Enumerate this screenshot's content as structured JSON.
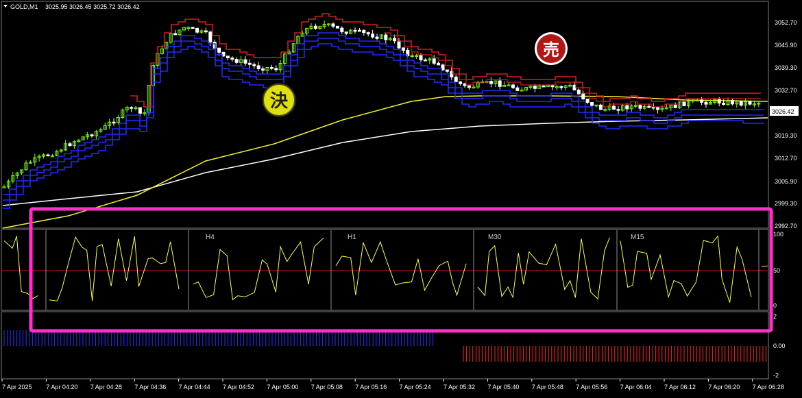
{
  "header": {
    "symbol": "GOLD,M1",
    "ohlc": "3025.95 3026.45 3025.72 3026.42"
  },
  "price_axis": {
    "labels": [
      "3052.70",
      "3045.90",
      "3039.30",
      "3032.70",
      "3026.42",
      "3019.30",
      "3012.70",
      "3005.90",
      "2999.30",
      "2992.70"
    ],
    "current_price": "3026.42"
  },
  "signals": {
    "exit_label": "決",
    "sell_label": "売"
  },
  "stoch_panel": {
    "levels": [
      "100",
      "50",
      "0"
    ],
    "timeframes": [
      "H4",
      "H1",
      "M30",
      "M15"
    ]
  },
  "histogram_panel": {
    "levels": [
      "2",
      "0.00",
      "-2"
    ]
  },
  "time_axis": {
    "labels": [
      "7 Apr 2025",
      "7 Apr 04:20",
      "7 Apr 04:28",
      "7 Apr 04:36",
      "7 Apr 04:44",
      "7 Apr 04:52",
      "7 Apr 05:00",
      "7 Apr 05:08",
      "7 Apr 05:16",
      "7 Apr 05:24",
      "7 Apr 05:32",
      "7 Apr 05:40",
      "7 Apr 05:48",
      "7 Apr 05:56",
      "7 Apr 06:04",
      "7 Apr 06:12",
      "7 Apr 06:20",
      "7 Apr 06:28"
    ]
  },
  "colors": {
    "background": "#000000",
    "bull_candle": "#7cfc00",
    "bear_candle": "#ffffff",
    "channel_blue": "#1e2cff",
    "channel_red": "#d22020",
    "ma_yellow": "#f2f232",
    "ma_white": "#ffffff",
    "stoch_line": "#ffff40",
    "mid_line": "#c01818",
    "hist_blue": "#2030ff",
    "hist_red": "#ff2020",
    "highlight": "#ff30c8",
    "sell_badge": "#b01818",
    "exit_badge": "#e0e010"
  }
}
